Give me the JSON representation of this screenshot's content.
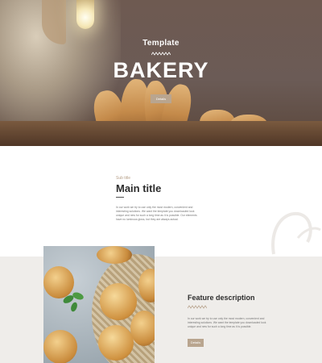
{
  "hero": {
    "subtitle": "Template",
    "title": "BAKERY",
    "button_label": "Details"
  },
  "intro": {
    "sub_title": "Sub title",
    "main_title": "Main title",
    "paragraph_lines": [
      "In our work we try to use only the most modern, convenient and",
      "interesting solutions. We want the template you downloaded look",
      "unique and new for such a long time as it is possible. Our elements",
      "have no luminous gloss, but they are always actual."
    ]
  },
  "feature": {
    "title": "Feature description",
    "paragraph_lines": [
      "In our work we try to use only the most modern, convenient and",
      "interesting solutions. We want the template you downloaded look",
      "unique and new for such a long time as it is possible."
    ],
    "button_label": "Details"
  },
  "colors": {
    "accent": "#b9a58f",
    "feature_background": "#efedea",
    "heading": "#2d2d2d"
  }
}
